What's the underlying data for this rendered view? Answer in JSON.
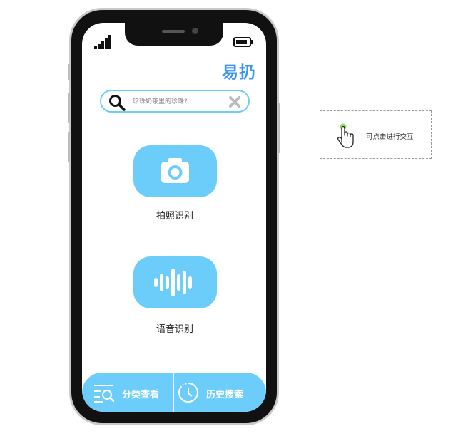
{
  "app": {
    "title": "易扔"
  },
  "search": {
    "placeholder": "珍珠奶茶里的珍珠?"
  },
  "actions": [
    {
      "label": "拍照识别",
      "icon": "camera-icon"
    },
    {
      "label": "语音识别",
      "icon": "sound-wave-icon"
    }
  ],
  "bottom_nav": [
    {
      "label": "分类查看",
      "icon": "list-search-icon"
    },
    {
      "label": "历史搜索",
      "icon": "history-clock-icon"
    }
  ],
  "hint": {
    "text": "可点击进行交互",
    "icon": "pointer-hand-icon"
  },
  "colors": {
    "accent": "#6ccdfa",
    "title": "#3a95f0",
    "phone_frame": "#111111"
  }
}
